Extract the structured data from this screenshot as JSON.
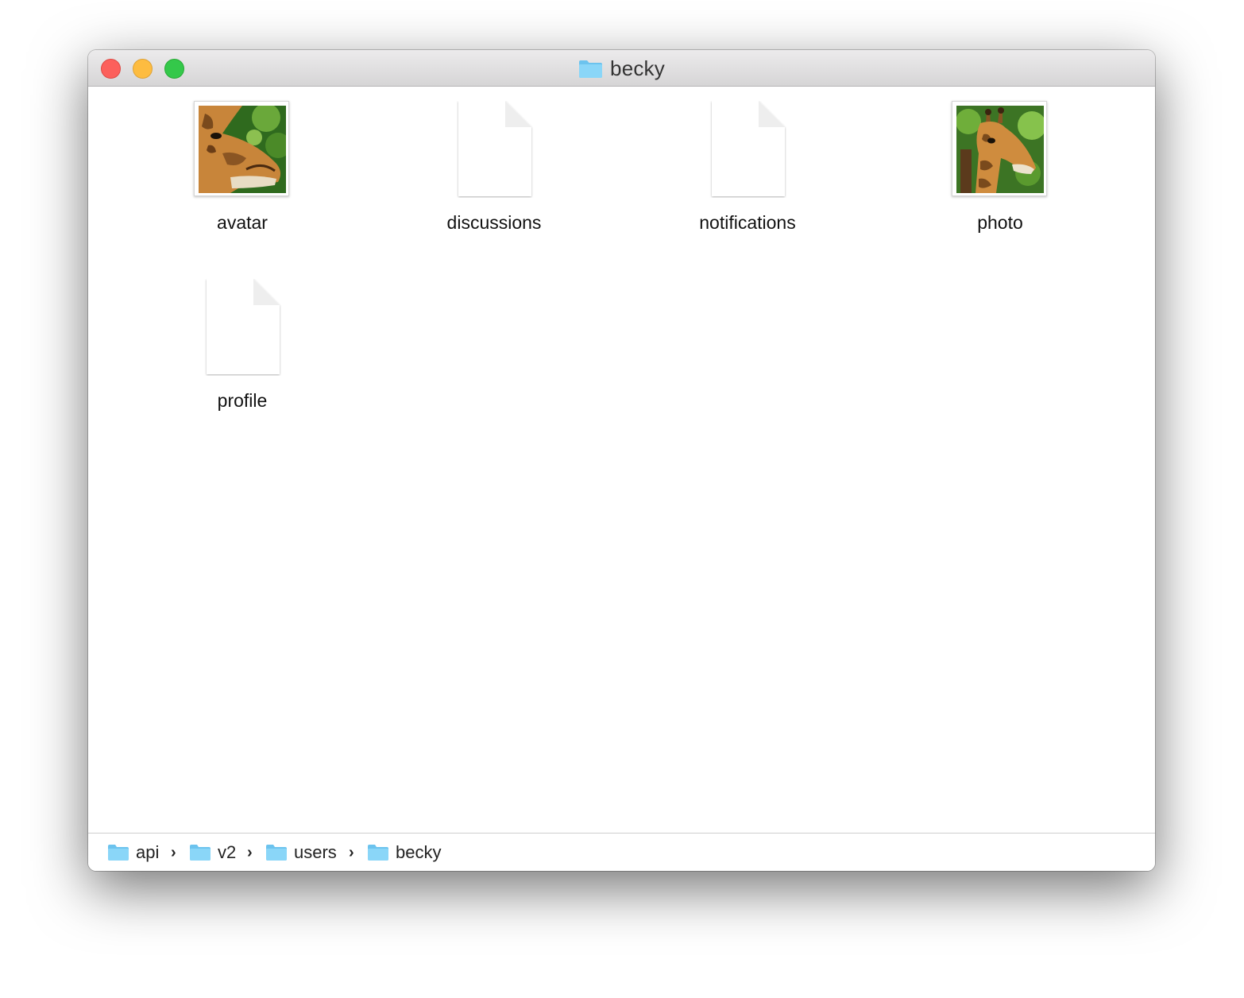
{
  "window": {
    "title": "becky",
    "title_icon": "folder-icon",
    "controls": [
      "close",
      "minimize",
      "zoom"
    ],
    "colors": {
      "close": "#fc605c",
      "minimize": "#fdbc40",
      "zoom": "#34c84a",
      "folder": "#7fd0f5"
    }
  },
  "files": [
    {
      "name": "avatar",
      "icon": "image-thumbnail-icon"
    },
    {
      "name": "discussions",
      "icon": "document-icon"
    },
    {
      "name": "notifications",
      "icon": "document-icon"
    },
    {
      "name": "photo",
      "icon": "image-thumbnail-icon"
    },
    {
      "name": "profile",
      "icon": "document-icon"
    }
  ],
  "path_bar": {
    "segments": [
      {
        "label": "api",
        "icon": "folder-icon"
      },
      {
        "label": "v2",
        "icon": "folder-icon"
      },
      {
        "label": "users",
        "icon": "folder-icon"
      },
      {
        "label": "becky",
        "icon": "folder-icon"
      }
    ],
    "separator": "›"
  }
}
